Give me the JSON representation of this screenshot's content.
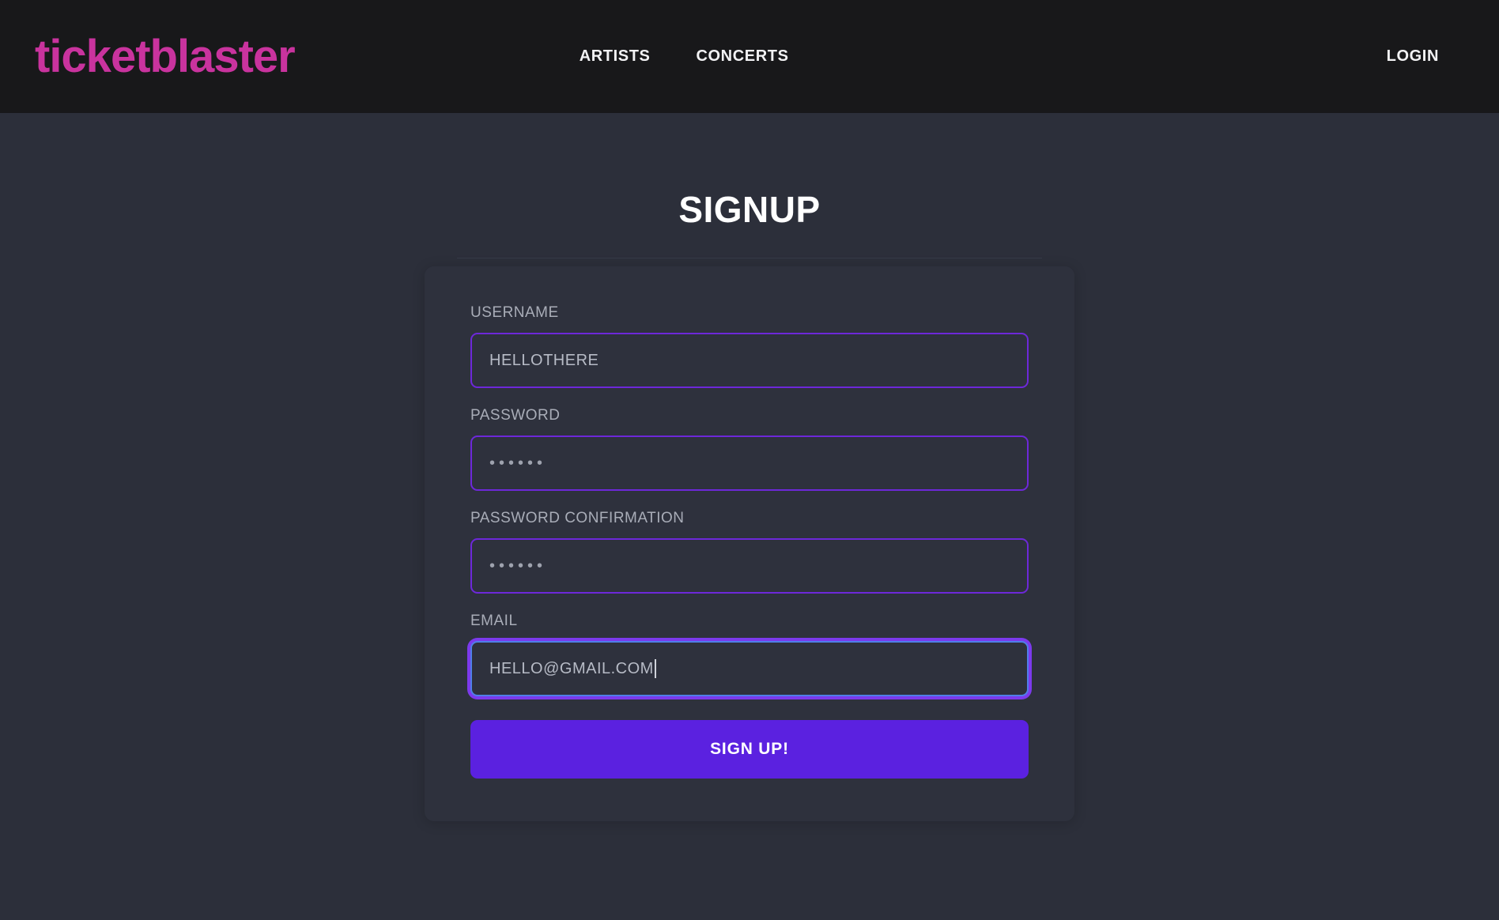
{
  "header": {
    "brand": "ticketblaster",
    "nav_links": [
      {
        "label": "ARTISTS"
      },
      {
        "label": "CONCERTS"
      }
    ],
    "login_label": "LOGIN"
  },
  "main": {
    "title": "SIGNUP",
    "form": {
      "fields": [
        {
          "label": "USERNAME",
          "value": "HELLOTHERE",
          "placeholder": "HELLOTHERE",
          "type": "text",
          "focused": false
        },
        {
          "label": "PASSWORD",
          "value": "••••••",
          "placeholder": "",
          "type": "password",
          "focused": false
        },
        {
          "label": "PASSWORD CONFIRMATION",
          "value": "••••••",
          "placeholder": "",
          "type": "password",
          "focused": false
        },
        {
          "label": "EMAIL",
          "value": "HELLO@GMAIL.COM",
          "placeholder": "",
          "type": "email",
          "focused": true
        }
      ],
      "submit_label": "SIGN UP!"
    }
  },
  "colors": {
    "brand_pink": "#c9339e",
    "header_bg": "#18181a",
    "page_bg": "#2c2f3a",
    "card_bg": "#2e313d",
    "input_border": "#6d28d9",
    "focus_ring": "#7c3aed",
    "focus_border": "#4f7fe8",
    "button_bg": "#5b21e0",
    "label_text": "#a9adb8"
  }
}
